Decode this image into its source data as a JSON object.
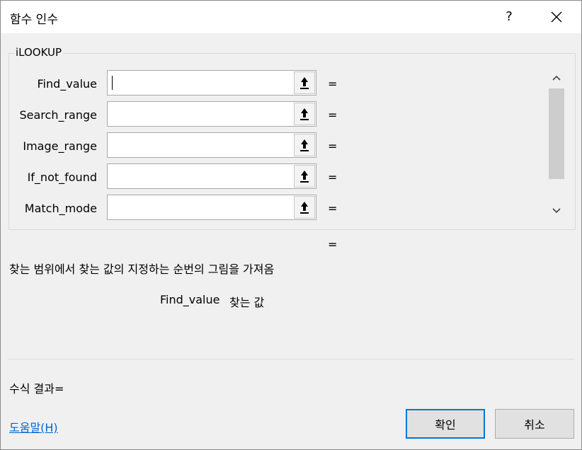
{
  "window": {
    "title": "함수 인수",
    "help_symbol": "?"
  },
  "function": {
    "name": "iLOOKUP",
    "arguments": [
      {
        "label": "Find_value",
        "value": "",
        "equals": "="
      },
      {
        "label": "Search_range",
        "value": "",
        "equals": "="
      },
      {
        "label": "Image_range",
        "value": "",
        "equals": "="
      },
      {
        "label": "If_not_found",
        "value": "",
        "equals": "="
      },
      {
        "label": "Match_mode",
        "value": "",
        "equals": "="
      }
    ],
    "result_equals": "=",
    "description": "찾는 범위에서 찾는 값의 지정하는 순번의 그림을 가져옴",
    "current_arg_name": "Find_value",
    "current_arg_help": "찾는 값"
  },
  "footer": {
    "formula_result": "수식 결과=",
    "help_link": "도움말(H)",
    "ok_label": "확인",
    "cancel_label": "취소"
  },
  "icons": {
    "close": "close-icon",
    "collapse": "collapse-dialog-icon",
    "scroll_up": "chevron-up-icon",
    "scroll_down": "chevron-down-icon"
  },
  "colors": {
    "accent": "#0078d7",
    "link": "#0066cc",
    "background": "#f0f0f0"
  }
}
